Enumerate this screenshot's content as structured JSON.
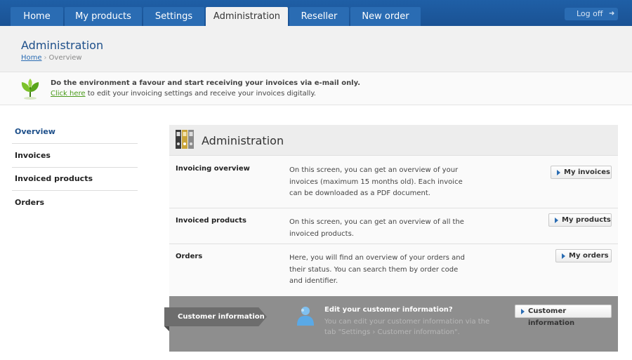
{
  "nav": {
    "tabs": [
      {
        "label": "Home"
      },
      {
        "label": "My products"
      },
      {
        "label": "Settings"
      },
      {
        "label": "Administration",
        "active": true
      },
      {
        "label": "Reseller"
      },
      {
        "label": "New order"
      }
    ],
    "logoff": "Log off"
  },
  "page": {
    "title": "Administration",
    "breadcrumb": {
      "home": "Home",
      "separator": "›",
      "current": "Overview"
    }
  },
  "banner": {
    "title": "Do the environment a favour and start receiving your invoices via e-mail only.",
    "link": "Click here",
    "text": " to edit your invoicing settings and receive your invoices digitally."
  },
  "sidebar": {
    "items": [
      {
        "label": "Overview",
        "active": true
      },
      {
        "label": "Invoices"
      },
      {
        "label": "Invoiced products"
      },
      {
        "label": "Orders"
      }
    ]
  },
  "panel": {
    "title": "Administration",
    "rows": [
      {
        "title": "Invoicing overview",
        "desc": "On this screen, you can get an overview of your invoices (maximum 15 months old). Each invoice can be downloaded as a PDF document.",
        "button": "My invoices"
      },
      {
        "title": "Invoiced products",
        "desc": "On this screen, you can get an overview of all the invoiced products.",
        "button": "My products"
      },
      {
        "title": "Orders",
        "desc": "Here, you will find an overview of your orders and their status. You can search them by order code and identifier.",
        "button": "My orders"
      }
    ],
    "customer": {
      "tag": "Customer information",
      "title": "Edit your customer information?",
      "text": "You can edit your customer information via the tab \"Settings › Customer information\".",
      "button": "Customer information"
    }
  },
  "colors": {
    "nav": "#1a5294",
    "accent": "#1d4f8a",
    "link_green": "#4a9a1a",
    "customer_band": "#8e8e8e"
  }
}
